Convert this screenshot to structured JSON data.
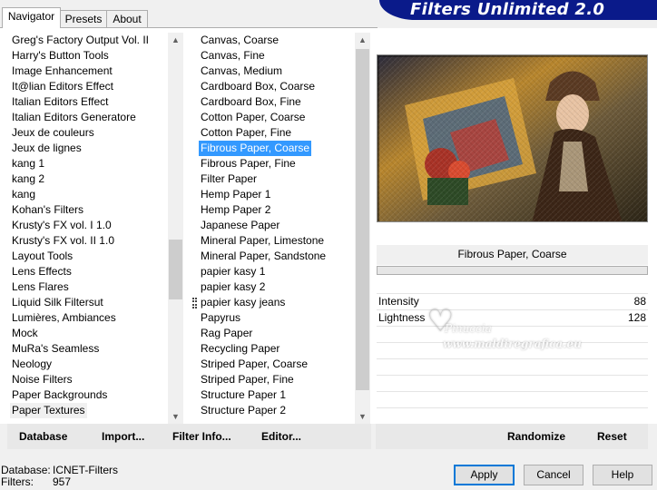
{
  "tabs": [
    {
      "label": "Navigator"
    },
    {
      "label": "Presets"
    },
    {
      "label": "About"
    }
  ],
  "banner": {
    "title": "Filters Unlimited 2.0"
  },
  "categories": {
    "items": [
      "Greg's Factory Output Vol. II",
      "Harry's Button Tools",
      "Image Enhancement",
      "It@lian Editors Effect",
      "Italian Editors Effect",
      "Italian Editors Generatore",
      "Jeux de couleurs",
      "Jeux de lignes",
      "kang 1",
      "kang 2",
      "kang",
      "Kohan's Filters",
      "Krusty's FX vol. I 1.0",
      "Krusty's FX vol. II 1.0",
      "Layout Tools",
      "Lens Effects",
      "Lens Flares",
      "Liquid Silk Filtersut",
      "Lumières, Ambiances",
      "Mock",
      "MuRa's Seamless",
      "Neology",
      "Noise Filters",
      "Paper Backgrounds",
      "Paper Textures"
    ],
    "highlighted_index": 24
  },
  "filters": {
    "items": [
      "Canvas, Coarse",
      "Canvas, Fine",
      "Canvas, Medium",
      "Cardboard Box, Coarse",
      "Cardboard Box, Fine",
      "Cotton Paper, Coarse",
      "Cotton Paper, Fine",
      "Fibrous Paper, Coarse",
      "Fibrous Paper, Fine",
      "Filter Paper",
      "Hemp Paper 1",
      "Hemp Paper 2",
      "Japanese Paper",
      "Mineral Paper, Limestone",
      "Mineral Paper, Sandstone",
      "papier kasy 1",
      "papier kasy 2",
      "papier kasy jeans",
      "Papyrus",
      "Rag Paper",
      "Recycling Paper",
      "Striped Paper, Coarse",
      "Striped Paper, Fine",
      "Structure Paper 1",
      "Structure Paper 2"
    ],
    "selected_index": 7
  },
  "left_buttons": {
    "database": "Database",
    "import": "Import...",
    "filter_info": "Filter Info...",
    "editor": "Editor..."
  },
  "right_buttons": {
    "randomize": "Randomize",
    "reset": "Reset"
  },
  "filter_title": "Fibrous Paper, Coarse",
  "controls": [
    {
      "label": "Intensity",
      "value": "88"
    },
    {
      "label": "Lightness",
      "value": "128"
    }
  ],
  "watermark": {
    "line1": "Pinuccia",
    "line2": "www.maldiregrafica.eu"
  },
  "status": {
    "database_label": "Database:",
    "database_value": "ICNET-Filters",
    "filters_label": "Filters:",
    "filters_value": "957"
  },
  "dialog_buttons": {
    "apply": "Apply",
    "cancel": "Cancel",
    "help": "Help"
  },
  "colors": {
    "selection": "#3399ff",
    "banner": "#0a1a8a",
    "default_button_border": "#0078d7"
  }
}
